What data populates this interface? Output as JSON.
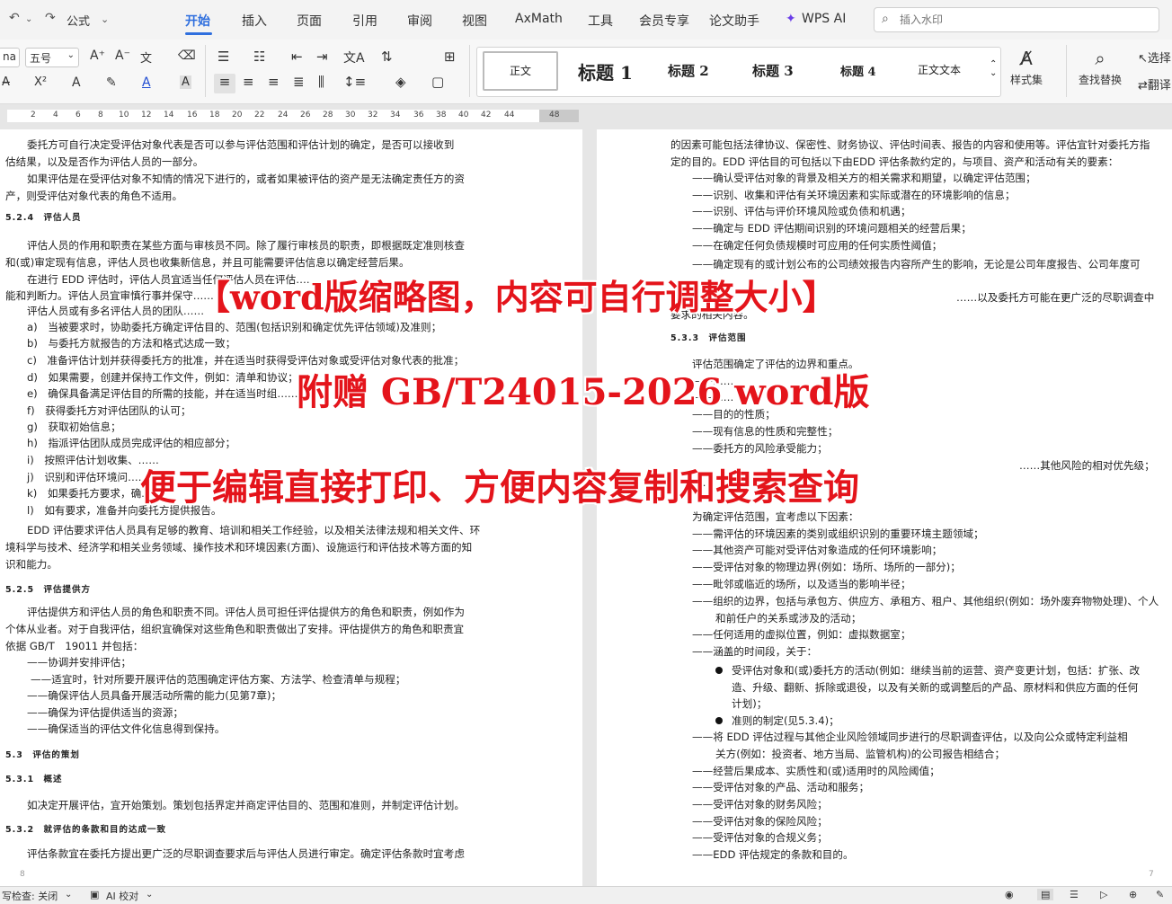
{
  "ribbon": {
    "quick_access": {
      "undo_icon": "↶",
      "redo_icon": "↷",
      "formula": "公式"
    },
    "tabs": [
      "开始",
      "插入",
      "页面",
      "引用",
      "审阅",
      "视图",
      "AxMath",
      "工具",
      "会员专享",
      "论文助手",
      "WPS AI"
    ],
    "active_tab": "开始",
    "search_placeholder": "插入水印"
  },
  "toolbar": {
    "font_name": "na",
    "font_size": "五号",
    "styles": [
      "正文",
      "标题 1",
      "标题 2",
      "标题 3",
      "标题 4",
      "正文文本"
    ],
    "style_set": "样式集",
    "find_replace": "查找替换",
    "select": "选择",
    "translate": "翻译",
    "superscript": "X²",
    "letter_a": "A"
  },
  "ruler": {
    "ticks": [
      "2",
      "4",
      "6",
      "8",
      "10",
      "12",
      "14",
      "16",
      "18",
      "20",
      "22",
      "24",
      "26",
      "28",
      "30",
      "32",
      "34",
      "36",
      "38",
      "40",
      "42",
      "44",
      "48"
    ]
  },
  "left_page": {
    "lines": [
      "委托方可自行决定受评估对象代表是否可以参与评估范围和评估计划的确定，是否可以接收到",
      "估结果，以及是否作为评估人员的一部分。",
      "如果评估是在受评估对象不知情的情况下进行的，或者如果被评估的资产是无法确定责任方的资",
      "产，则受评估对象代表的角色不适用。",
      "5.2.4　评估人员",
      "评估人员的作用和职责在某些方面与审核员不同。除了履行审核员的职责，即根据既定准则核查",
      "和(或)审定现有信息，评估人员也收集新信息，并且可能需要评估信息以确定经营后果。",
      "在进行 EDD 评估时，评估人员宜适当任何评估人员在评估……",
      "能和判断力。评估人员宜审慎行事并保守……",
      "评估人员或有多名评估人员的团队……",
      "a)　当被要求时，协助委托方确定评估目的、范围(包括识别和确定优先评估领域)及准则；",
      "b)　与委托方就报告的方法和格式达成一致；",
      "c)　准备评估计划并获得委托方的批准，并在适当时获得受评估对象或受评估对象代表的批准；",
      "d)　如果需要，创建并保持工作文件，例如：清单和协议；",
      "e)　确保具备满足评估目的所需的技能，并在适当时组……",
      "f)　获得委托方对评估团队的认可；",
      "g)　获取初始信息；",
      "h)　指派评估团队成员完成评估的相应部分；",
      "i)　按照评估计划收集、……",
      "j)　识别和评估环境问……",
      "k)　如果委托方要求，确……",
      "l)　如有要求，准备并向委托方提供报告。",
      "EDD 评估要求评估人员具有足够的教育、培训和相关工作经验，以及相关法律法规和相关文件、环",
      "境科学与技术、经济学和相关业务领域、操作技术和环境因素(方面)、设施运行和评估技术等方面的知",
      "识和能力。",
      "5.2.5　评估提供方",
      "评估提供方和评估人员的角色和职责不同。评估人员可担任评估提供方的角色和职责，例如作为",
      "个体从业者。对于自我评估，组织宜确保对这些角色和职责做出了安排。评估提供方的角色和职责宜",
      "依据 GB/T　19011 并包括：",
      "——协调并安排评估；",
      "——适宜时，针对所要开展评估的范围确定评估方案、方法学、检查清单与规程；",
      "——确保评估人员具备开展活动所需的能力(见第7章)；",
      "——确保为评估提供适当的资源；",
      "——确保适当的评估文件化信息得到保持。",
      "5.3　评估的策划",
      "5.3.1　概述",
      "如决定开展评估，宜开始策划。策划包括界定并商定评估目的、范围和准则，并制定评估计划。",
      "5.3.2　就评估的条款和目的达成一致",
      "评估条款宜在委托方提出更广泛的尽职调查要求后与评估人员进行审定。确定评估条款时宜考虑"
    ],
    "page_number": "8"
  },
  "right_page": {
    "lines": [
      "的因素可能包括法律协议、保密性、财务协议、评估时间表、报告的内容和使用等。评估宜针对委托方指",
      "定的目的。EDD 评估目的可包括以下由EDD 评估条款约定的，与项目、资产和活动有关的要素：",
      "——确认受评估对象的背景及相关方的相关需求和期望，以确定评估范围；",
      "——识别、收集和评估有关环境因素和实际或潜在的环境影响的信息；",
      "——识别、评估与评价环境风险或负债和机遇；",
      "——确定与 EDD 评估期间识别的环境问题相关的经营后果；",
      "——在确定任何负债规模时可应用的任何实质性阈值；",
      "——确定现有的或计划公布的公司绩效报告内容所产生的影响，无论是公司年度报告、公司年度可",
      "……以及委托方可能在更广泛的尽职调查中",
      "要求的相关内容。",
      "5.3.3　评估范围",
      "评估范围确定了评估的边界和重点。",
      "——……",
      "——……",
      "——目的的性质；",
      "——现有信息的性质和完整性；",
      "——委托方的风险承受能力；",
      "……其他风险的相对优先级；",
      "……",
      "为确定评估范围，宜考虑以下因素：",
      "——需评估的环境因素的类别或组织识别的重要环境主题领域；",
      "——其他资产可能对受评估对象造成的任何环境影响；",
      "——受评估对象的物理边界(例如：场所、场所的一部分)；",
      "——毗邻或临近的场所，以及适当的影响半径；",
      "——组织的边界，包括与承包方、供应方、承租方、租户、其他组织(例如：场外废弃物物处理)、个人",
      "和前任户的关系或涉及的活动；",
      "——任何适用的虚拟位置，例如：虚拟数据室；",
      "——涵盖的时间段，关于：",
      "受评估对象和(或)委托方的活动(例如：继续当前的运营、资产变更计划，包括：扩张、改",
      "造、升级、翻新、拆除或退役，以及有关新的或调整后的产品、原材料和供应方面的任何",
      "计划)；",
      "准则的制定(见5.3.4)；",
      "——将 EDD 评估过程与其他企业风险领域同步进行的尽职调查评估，以及向公众或特定利益相",
      "关方(例如：投资者、地方当局、监管机构)的公司报告相结合；",
      "——经营后果成本、实质性和(或)适用时的风险阈值；",
      "——受评估对象的产品、活动和服务；",
      "——受评估对象的财务风险；",
      "——受评估对象的保险风险；",
      "——受评估对象的合规义务；",
      "——EDD 评估规定的条款和目的。"
    ],
    "page_number": "7"
  },
  "overlay": {
    "line1": "【word版缩略图，内容可自行调整大小】",
    "line2": "附赠 GB/T24015-2026 word版",
    "line3": "便于编辑直接打印、方便内容复制和搜索查询",
    "color": "#e4141b"
  },
  "status_bar": {
    "spell_check": "写检查: 关闭",
    "ai_check": "AI 校对"
  }
}
